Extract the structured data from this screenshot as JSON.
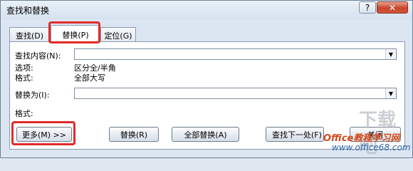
{
  "window": {
    "title": "查找和替换",
    "help_label": "?",
    "close_label": "✕"
  },
  "tabs": [
    {
      "label": "查找(D)"
    },
    {
      "label": "替换(P)"
    },
    {
      "label": "定位(G)"
    }
  ],
  "find": {
    "label": "查找内容(N):",
    "value": ""
  },
  "options": {
    "label": "选项:",
    "value": "区分全/半角"
  },
  "format1": {
    "label": "格式:",
    "value": "全部大写"
  },
  "replace": {
    "label": "替换为(I):",
    "value": ""
  },
  "format2": {
    "label": "格式:"
  },
  "buttons": {
    "more": "更多(M) >>",
    "replace": "替换(R)",
    "replace_all": "全部替换(A)",
    "find_next": "查找下一处(F)",
    "close": "关闭"
  },
  "watermark": {
    "logo": "下载吧",
    "brand": "Office教程学习网",
    "url": "www.office68.com"
  },
  "colors": {
    "highlight": "#e12b2b",
    "close_button": "#c7462c"
  }
}
